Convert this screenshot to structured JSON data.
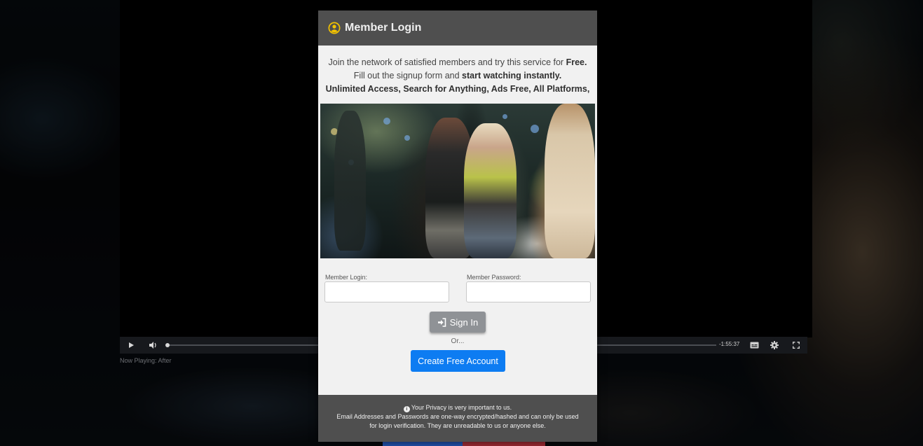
{
  "colors": {
    "modal_header": "#4f4f4f",
    "modal_body": "#f1f1f1",
    "user_icon": "#f2c200",
    "create_button": "#0d7cf2",
    "signin_button": "#8f9296"
  },
  "player": {
    "play_icon": "play-icon",
    "volume_icon": "volume-icon",
    "time_remaining": "-1:55:37",
    "progress": 0,
    "captions_icon": "captions-icon",
    "settings_icon": "gear-icon",
    "fullscreen_icon": "fullscreen-icon",
    "now_playing": "Now Playing: After"
  },
  "modal": {
    "title": "Member Login",
    "title_icon": "user-circle-icon",
    "intro": {
      "line1_prefix": "Join the network of satisfied members and try this service for ",
      "line1_bold": "Free.",
      "line2_prefix": "Fill out the signup form and ",
      "line2_bold": "start watching instantly.",
      "line3_bold": "Unlimited Access, Search for Anything, Ads Free, All Platforms,"
    },
    "login_label": "Member Login:",
    "login_value": "",
    "password_label": "Member Password:",
    "password_value": "",
    "signin_icon": "sign-in-icon",
    "signin_label": "Sign In",
    "or_text": "Or...",
    "create_label": "Create Free Account",
    "footer": {
      "info_icon": "info-icon",
      "line1": "Your Privacy is very important to us.",
      "line2": "Email Addresses and Passwords are one-way encrypted/hashed and can only be used",
      "line3": "for login verification. They are unreadable to us or anyone else."
    }
  }
}
